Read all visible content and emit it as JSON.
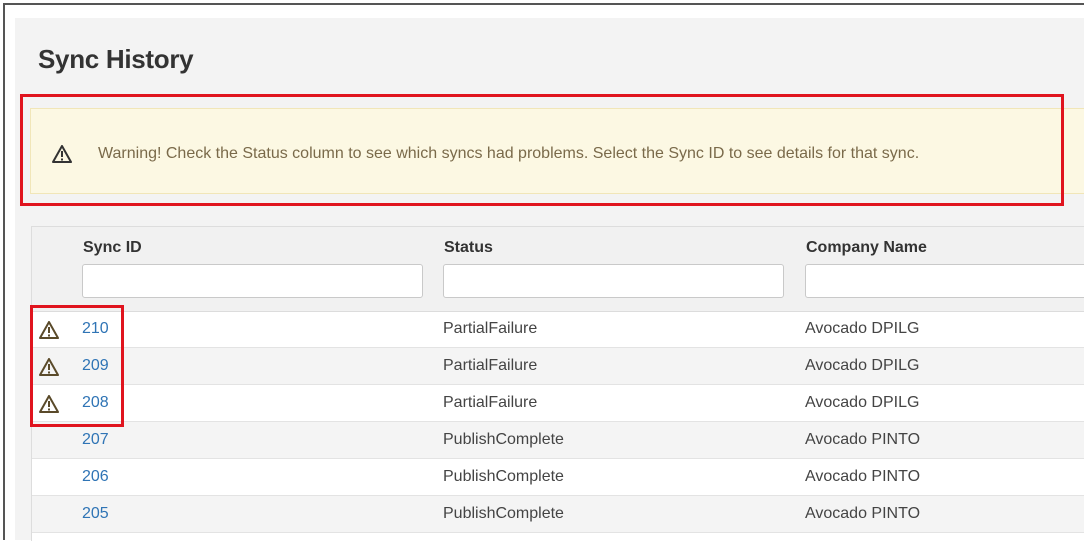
{
  "page": {
    "title": "Sync History"
  },
  "warning": {
    "icon": "warning-triangle-icon",
    "text": "Warning! Check the Status column to see which syncs had problems. Select the Sync ID to see details for that sync."
  },
  "grid": {
    "columns": [
      {
        "label": "Sync ID",
        "filter_value": ""
      },
      {
        "label": "Status",
        "filter_value": ""
      },
      {
        "label": "Company Name",
        "filter_value": ""
      }
    ],
    "rows": [
      {
        "sync_id": "210",
        "status": "PartialFailure",
        "company": "Avocado DPILG",
        "warning": true
      },
      {
        "sync_id": "209",
        "status": "PartialFailure",
        "company": "Avocado DPILG",
        "warning": true
      },
      {
        "sync_id": "208",
        "status": "PartialFailure",
        "company": "Avocado DPILG",
        "warning": true
      },
      {
        "sync_id": "207",
        "status": "PublishComplete",
        "company": "Avocado PINTO",
        "warning": false
      },
      {
        "sync_id": "206",
        "status": "PublishComplete",
        "company": "Avocado PINTO",
        "warning": false
      },
      {
        "sync_id": "205",
        "status": "PublishComplete",
        "company": "Avocado PINTO",
        "warning": false
      }
    ]
  },
  "colors": {
    "highlight": "#e0141e",
    "link": "#2f74b5",
    "warning_bg": "#fcf8e3"
  }
}
